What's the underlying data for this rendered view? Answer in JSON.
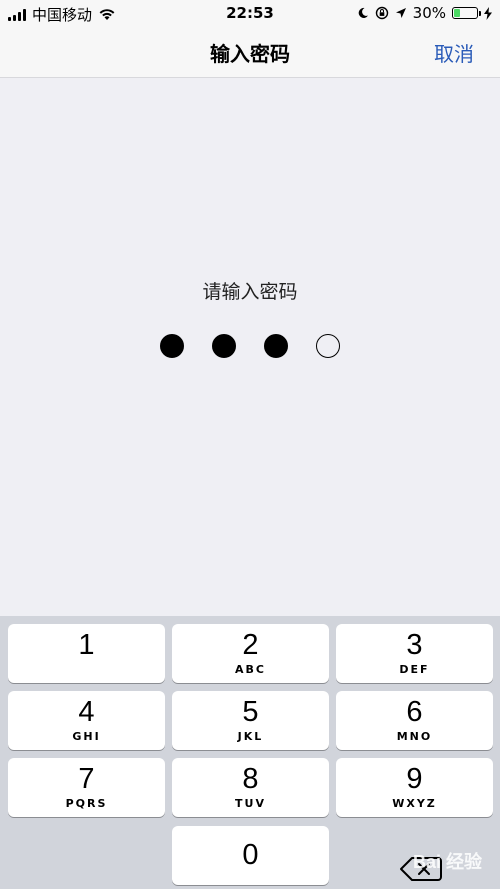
{
  "status_bar": {
    "carrier": "中国移动",
    "time": "22:53",
    "battery_percent": "30%",
    "battery_level": 0.3,
    "colors": {
      "battery": "#4cd964"
    }
  },
  "nav": {
    "title": "输入密码",
    "cancel_label": "取消",
    "accent": "#2a5bb8"
  },
  "passcode": {
    "prompt": "请输入密码",
    "total_digits": 4,
    "entered_digits": 3
  },
  "keypad": {
    "keys": [
      {
        "digit": "1",
        "letters": ""
      },
      {
        "digit": "2",
        "letters": "ABC"
      },
      {
        "digit": "3",
        "letters": "DEF"
      },
      {
        "digit": "4",
        "letters": "GHI"
      },
      {
        "digit": "5",
        "letters": "JKL"
      },
      {
        "digit": "6",
        "letters": "MNO"
      },
      {
        "digit": "7",
        "letters": "PQRS"
      },
      {
        "digit": "8",
        "letters": "TUV"
      },
      {
        "digit": "9",
        "letters": "WXYZ"
      },
      {
        "digit": "0",
        "letters": ""
      }
    ],
    "delete_icon": "delete-backspace-icon"
  },
  "watermark": "Bai 经验"
}
